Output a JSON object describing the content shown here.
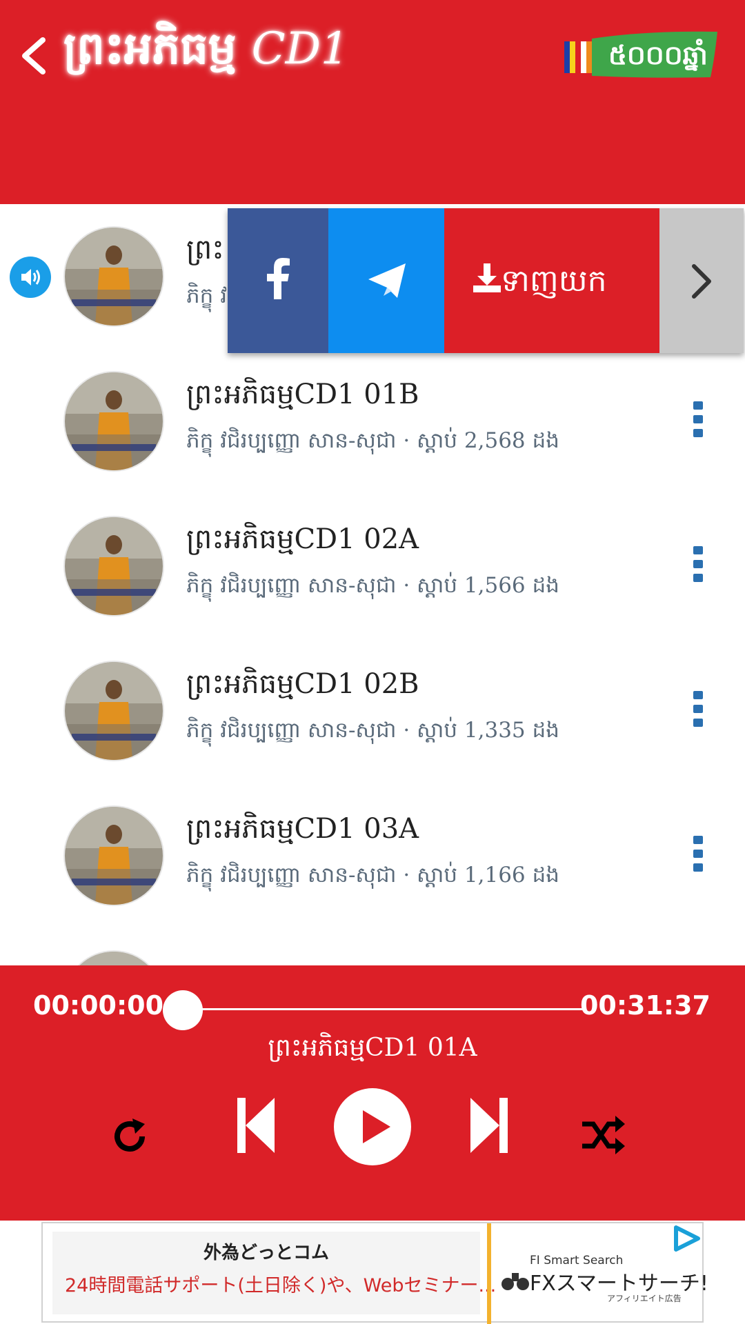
{
  "header": {
    "title_main": "ព្រះអភិធម្ម",
    "title_suffix": "CD1",
    "logo_text": "៥០០០ឆ្នាំ"
  },
  "share": {
    "download_label": "ទាញយក"
  },
  "tracks": [
    {
      "title": "ព្រះ",
      "subtitle": "ភិក្ខុ វ",
      "playing": true
    },
    {
      "title": "ព្រះអភិធម្មCD1 01B",
      "subtitle": "ភិក្ខុ វជិរប្បញ្ញោ សាន-សុជា · ស្តាប់ 2,568 ដង"
    },
    {
      "title": "ព្រះអភិធម្មCD1 02A",
      "subtitle": "ភិក្ខុ វជិរប្បញ្ញោ សាន-សុជា · ស្តាប់ 1,566 ដង"
    },
    {
      "title": "ព្រះអភិធម្មCD1 02B",
      "subtitle": "ភិក្ខុ វជិរប្បញ្ញោ សាន-សុជា · ស្តាប់ 1,335 ដង"
    },
    {
      "title": "ព្រះអភិធម្មCD1 03A",
      "subtitle": "ភិក្ខុ វជិរប្បញ្ញោ សាន-សុជា · ស្តាប់ 1,166 ដង"
    }
  ],
  "player": {
    "current_time": "00:00:00",
    "total_time": "00:31:37",
    "progress": 0,
    "now_playing": "ព្រះអភិធម្មCD1 01A"
  },
  "ad": {
    "title": "外為どっとコム",
    "description": "24時間電話サポート(土日除く)や、Webセミナー...",
    "logo_top": "FI Smart Search",
    "logo_main": "FXスマートサーチ!",
    "logo_sub": "アフィリエイト広告"
  },
  "colors": {
    "primary": "#dc1f27",
    "facebook": "#3b5898",
    "telegram": "#0d8df0",
    "accent_blue": "#2a6fb0"
  }
}
